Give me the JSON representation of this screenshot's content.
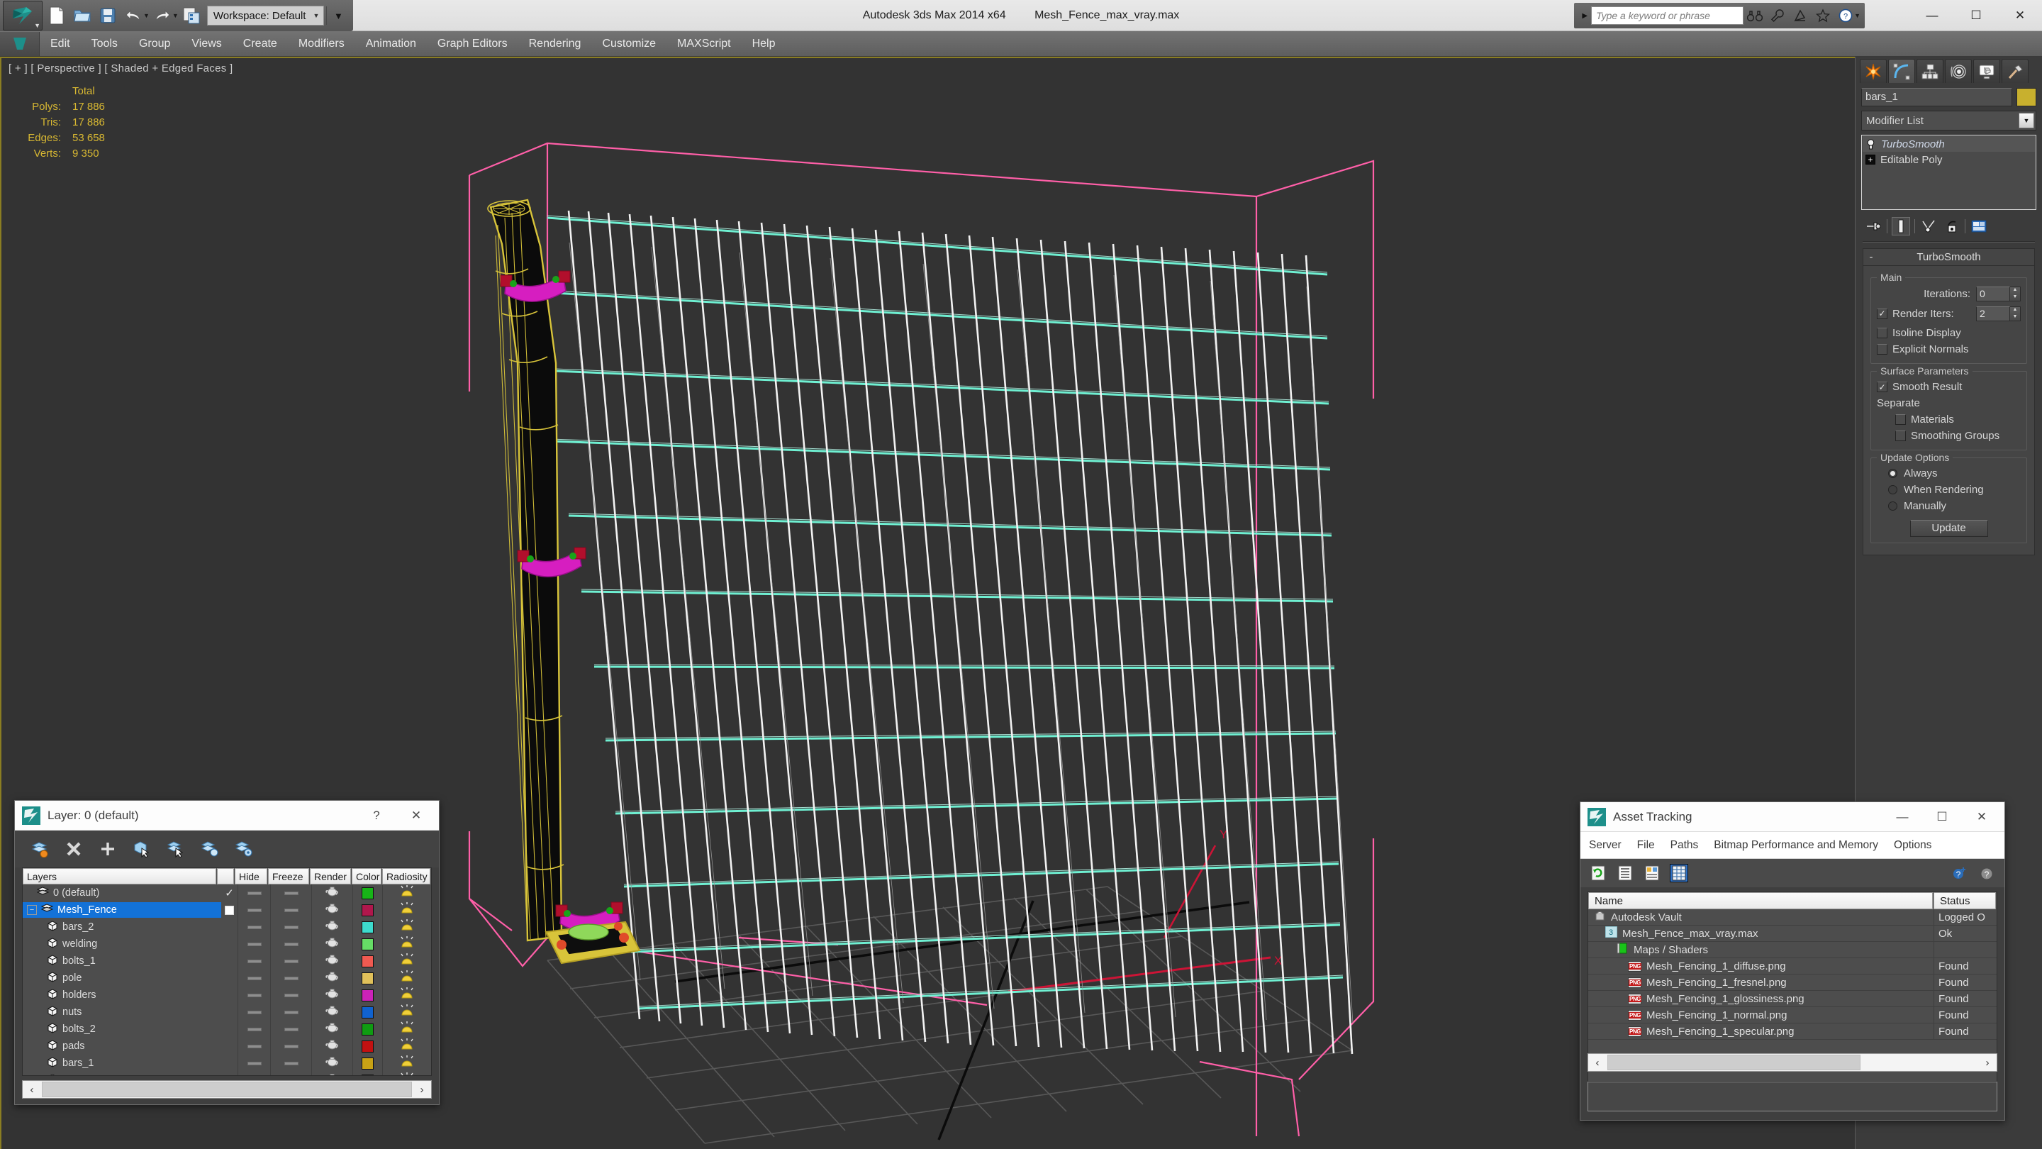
{
  "titlebar": {
    "app_title": "Autodesk 3ds Max  2014 x64",
    "file_title": "Mesh_Fence_max_vray.max",
    "workspace_label": "Workspace: Default",
    "search_placeholder": "Type a keyword or phrase",
    "quick_access": [
      {
        "name": "new-file",
        "icon": "page-icon"
      },
      {
        "name": "open-file",
        "icon": "folder-open-icon"
      },
      {
        "name": "save-file",
        "icon": "save-icon"
      },
      {
        "name": "undo",
        "icon": "undo-arrow-icon"
      },
      {
        "name": "redo",
        "icon": "redo-arrow-icon"
      },
      {
        "name": "project-folder",
        "icon": "project-folder-icon"
      }
    ],
    "help_icons": [
      "binoculars-icon",
      "wrench-icon",
      "satellite-icon",
      "star-icon",
      "help-circle-icon"
    ],
    "window_buttons": {
      "minimize": "—",
      "maximize": "☐",
      "close": "✕"
    }
  },
  "menubar": {
    "items": [
      "Edit",
      "Tools",
      "Group",
      "Views",
      "Create",
      "Modifiers",
      "Animation",
      "Graph Editors",
      "Rendering",
      "Customize",
      "MAXScript",
      "Help"
    ]
  },
  "viewport": {
    "label": "[ + ] [ Perspective ] [ Shaded + Edged Faces ]",
    "stats": {
      "header": "Total",
      "rows": [
        {
          "label": "Polys:",
          "value": "17 886"
        },
        {
          "label": "Tris:",
          "value": "17 886"
        },
        {
          "label": "Edges:",
          "value": "53 658"
        },
        {
          "label": "Verts:",
          "value": "9 350"
        }
      ]
    },
    "axis_labels": {
      "x": "X",
      "y": "Y"
    },
    "colors": {
      "background": "#333333",
      "border": "#8a7d22",
      "selection_box": "#ff5fa8",
      "mesh_wire_white": "#f2f2f2",
      "mesh_wire_cyan": "#6ff0d2",
      "post_yellow": "#d8c43a",
      "holder_magenta": "#d61ec0",
      "stats_text": "#d8b832"
    }
  },
  "command_panel": {
    "tabs": [
      {
        "name": "create-tab",
        "icon": "star-burst-icon",
        "active": false
      },
      {
        "name": "modify-tab",
        "icon": "curve-arc-icon",
        "active": true
      },
      {
        "name": "hierarchy-tab",
        "icon": "hierarchy-icon",
        "active": false
      },
      {
        "name": "motion-tab",
        "icon": "motion-wheel-icon",
        "active": false
      },
      {
        "name": "display-tab",
        "icon": "monitor-icon",
        "active": false
      },
      {
        "name": "utilities-tab",
        "icon": "hammer-icon",
        "active": false
      }
    ],
    "object_name": "bars_1",
    "object_color": "#c8b02e",
    "modifier_list_label": "Modifier List",
    "stack": [
      {
        "label": "TurboSmooth",
        "selected": true,
        "icon": "light-bulb-icon"
      },
      {
        "label": "Editable Poly",
        "selected": false,
        "icon": "plus-box-icon"
      }
    ],
    "stack_tools": [
      "pin-stack-icon",
      "show-end-result-icon",
      "make-unique-icon",
      "remove-modifier-icon",
      "configure-sets-icon"
    ],
    "rollout": {
      "title": "TurboSmooth",
      "minus": "-",
      "groups": [
        {
          "title": "Main",
          "iterations_label": "Iterations:",
          "iterations_value": "0",
          "render_iters_label": "Render Iters:",
          "render_iters_value": "2",
          "render_iters_checked": true,
          "checkboxes": [
            {
              "label": "Isoline Display",
              "checked": false
            },
            {
              "label": "Explicit Normals",
              "checked": false
            }
          ]
        },
        {
          "title": "Surface Parameters",
          "smooth_result": {
            "label": "Smooth Result",
            "checked": true
          },
          "separate_label": "Separate",
          "separate_items": [
            {
              "label": "Materials",
              "checked": false
            },
            {
              "label": "Smoothing Groups",
              "checked": false
            }
          ]
        },
        {
          "title": "Update Options",
          "options": [
            {
              "label": "Always",
              "selected": true
            },
            {
              "label": "When Rendering",
              "selected": false
            },
            {
              "label": "Manually",
              "selected": false
            }
          ],
          "update_button": "Update"
        }
      ]
    }
  },
  "layer_window": {
    "title": "Layer: 0 (default)",
    "help_btn": "?",
    "close_btn": "✕",
    "toolbar": [
      "new-layer-icon",
      "delete-layer-icon",
      "add-layer-icon",
      "select-objects-icon",
      "select-highlighted-icon",
      "highlight-selected-icon",
      "layer-properties-icon"
    ],
    "columns": [
      "Layers",
      "",
      "Hide",
      "Freeze",
      "Render",
      "Color",
      "Radiosity"
    ],
    "rows": [
      {
        "name": "0 (default)",
        "indent": 1,
        "type": "layer",
        "current": true,
        "check": "✓",
        "color": "#17b417",
        "selected": false
      },
      {
        "name": "Mesh_Fence",
        "indent": 0,
        "type": "layer",
        "current": false,
        "check": "",
        "color": "#b0174c",
        "selected": true,
        "expander": "−"
      },
      {
        "name": "bars_2",
        "indent": 2,
        "type": "object",
        "color": "#3ddbcd",
        "selected": false
      },
      {
        "name": "welding",
        "indent": 2,
        "type": "object",
        "color": "#66dd66",
        "selected": false
      },
      {
        "name": "bolts_1",
        "indent": 2,
        "type": "object",
        "color": "#f05a51",
        "selected": false
      },
      {
        "name": "pole",
        "indent": 2,
        "type": "object",
        "color": "#e0c05a",
        "selected": false
      },
      {
        "name": "holders",
        "indent": 2,
        "type": "object",
        "color": "#cc22b8",
        "selected": false
      },
      {
        "name": "nuts",
        "indent": 2,
        "type": "object",
        "color": "#1062cf",
        "selected": false
      },
      {
        "name": "bolts_2",
        "indent": 2,
        "type": "object",
        "color": "#0f9c12",
        "selected": false
      },
      {
        "name": "pads",
        "indent": 2,
        "type": "object",
        "color": "#c21111",
        "selected": false
      },
      {
        "name": "bars_1",
        "indent": 2,
        "type": "object",
        "color": "#c8a215",
        "selected": false
      },
      {
        "name": "Mesh_Fence",
        "indent": 2,
        "type": "object",
        "color": "#000000",
        "selected": false
      }
    ],
    "scroll_left_arrow": "‹",
    "scroll_right_arrow": "›"
  },
  "asset_window": {
    "title": "Asset Tracking",
    "window_buttons": {
      "minimize": "—",
      "maximize": "☐",
      "close": "✕"
    },
    "menu": [
      "Server",
      "File",
      "Paths",
      "Bitmap Performance and Memory",
      "Options"
    ],
    "toolbar": [
      {
        "name": "refresh-icon",
        "active": false
      },
      {
        "name": "list-view-icon",
        "active": false
      },
      {
        "name": "detail-view-icon",
        "active": false
      },
      {
        "name": "grid-view-icon",
        "active": true
      }
    ],
    "toolbar_right": [
      "add-help-icon",
      "help-icon"
    ],
    "columns": [
      "Name",
      "Status"
    ],
    "rows": [
      {
        "name": "Autodesk Vault",
        "status": "Logged O",
        "indent": 0,
        "icon": "vault-icon"
      },
      {
        "name": "Mesh_Fence_max_vray.max",
        "status": "Ok",
        "indent": 1,
        "icon": "max-file-icon"
      },
      {
        "name": "Maps / Shaders",
        "status": "",
        "indent": 2,
        "icon": "maps-shaders-icon"
      },
      {
        "name": "Mesh_Fencing_1_diffuse.png",
        "status": "Found",
        "indent": 3,
        "icon": "png-icon"
      },
      {
        "name": "Mesh_Fencing_1_fresnel.png",
        "status": "Found",
        "indent": 3,
        "icon": "png-icon"
      },
      {
        "name": "Mesh_Fencing_1_glossiness.png",
        "status": "Found",
        "indent": 3,
        "icon": "png-icon"
      },
      {
        "name": "Mesh_Fencing_1_normal.png",
        "status": "Found",
        "indent": 3,
        "icon": "png-icon"
      },
      {
        "name": "Mesh_Fencing_1_specular.png",
        "status": "Found",
        "indent": 3,
        "icon": "png-icon"
      }
    ],
    "scroll_left_arrow": "‹",
    "scroll_right_arrow": "›"
  }
}
